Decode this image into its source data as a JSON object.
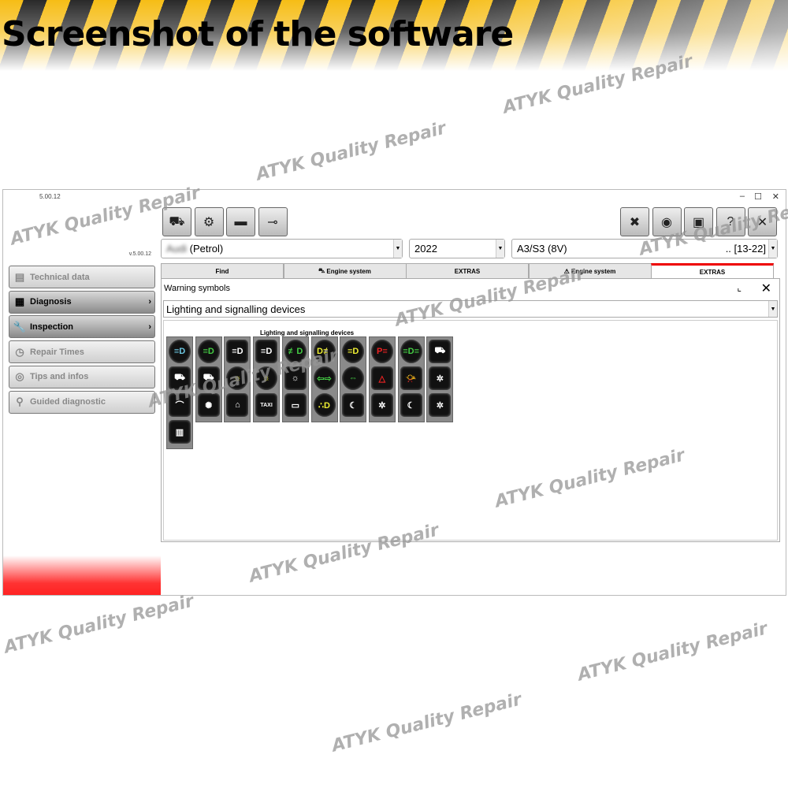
{
  "banner": {
    "title": "Screenshot of the software"
  },
  "watermark": "ATYK Quality Repair",
  "window": {
    "title": "5.00.12",
    "controls": [
      "–",
      "☐",
      "✕"
    ],
    "version": "v.5.00.12"
  },
  "sidebar": {
    "items": [
      {
        "label": "Technical data",
        "icon": "document-icon",
        "glyph": "▤",
        "active": false,
        "chevron": ""
      },
      {
        "label": "Diagnosis",
        "icon": "diagnosis-icon",
        "glyph": "▦",
        "active": true,
        "chevron": "›"
      },
      {
        "label": "Inspection",
        "icon": "wrench-icon",
        "glyph": "🔧",
        "active": true,
        "chevron": "›"
      },
      {
        "label": "Repair Times",
        "icon": "clock-icon",
        "glyph": "◷",
        "active": false,
        "chevron": ""
      },
      {
        "label": "Tips and infos",
        "icon": "lightbulb-icon",
        "glyph": "◎",
        "active": false,
        "chevron": ""
      },
      {
        "label": "Guided diagnostic",
        "icon": "magnifier-icon",
        "glyph": "⚲",
        "active": false,
        "chevron": ""
      }
    ]
  },
  "toolbar": {
    "left": [
      {
        "icon": "cars-icon",
        "glyph": "⛟"
      },
      {
        "icon": "engine-icon",
        "glyph": "⚙"
      },
      {
        "icon": "battery-icon",
        "glyph": "▬"
      },
      {
        "icon": "connector-icon",
        "glyph": "⊸"
      }
    ],
    "right": [
      {
        "icon": "tools-icon",
        "glyph": "✖"
      },
      {
        "icon": "wheel-icon",
        "glyph": "◉"
      },
      {
        "icon": "gearbox-icon",
        "glyph": "▣"
      },
      {
        "icon": "help-icon",
        "glyph": "?"
      },
      {
        "icon": "close-icon",
        "glyph": "✕"
      }
    ]
  },
  "selectors": {
    "make": "(Petrol)",
    "year": "2022",
    "model": "A3/S3 (8V)",
    "model_range": ".. [13-22]"
  },
  "tabs": [
    {
      "label": "Find",
      "icon": ""
    },
    {
      "label": "Engine system",
      "icon": "engine-icon"
    },
    {
      "label": "EXTRAS",
      "icon": ""
    },
    {
      "label": "Engine system",
      "icon": "warning-icon"
    },
    {
      "label": "EXTRAS",
      "icon": "",
      "active": true
    }
  ],
  "panel": {
    "title": "Warning symbols",
    "category": "Lighting and signalling devices",
    "grid_label": "Lighting and signalling devices"
  },
  "colors": {
    "accent": "#e00000",
    "active_tab": "#e00000"
  },
  "symbols": [
    [
      {
        "g": "≡D",
        "c": "#6cc6e0",
        "n": "low-beam-icon",
        "r": 1
      },
      {
        "g": "⛟",
        "c": "#fff",
        "n": "tow-truck-icon"
      },
      {
        "g": "⌒",
        "c": "#fff",
        "n": "work-light-icon"
      },
      {
        "g": "▥",
        "c": "#fff",
        "n": "interior-light-icon"
      }
    ],
    [
      {
        "g": "≡D",
        "c": "#4c4",
        "n": "high-beam-icon",
        "r": 1
      },
      {
        "g": "⛟",
        "c": "#fff",
        "n": "truck-light-icon"
      },
      {
        "g": "✺",
        "c": "#fff",
        "n": "search-light-icon"
      }
    ],
    [
      {
        "g": "≡D",
        "c": "#fff",
        "n": "headlight-range-icon"
      },
      {
        "g": "☼",
        "c": "#ee3",
        "n": "exterior-bulb-icon",
        "r": 1
      },
      {
        "g": "⌂",
        "c": "#fff",
        "n": "beacon-icon"
      }
    ],
    [
      {
        "g": "≡D",
        "c": "#fff",
        "n": "headlight-adjust-icon"
      },
      {
        "g": "☼",
        "c": "#ee3",
        "n": "bulb-failure-icon",
        "r": 1
      },
      {
        "g": "TAXI",
        "c": "#fff",
        "n": "taxi-icon"
      }
    ],
    [
      {
        "g": "≢D",
        "c": "#4c4",
        "n": "front-fog-icon",
        "r": 1
      },
      {
        "g": "☼",
        "c": "#fff",
        "n": "dimmer-icon"
      },
      {
        "g": "▭",
        "c": "#fff",
        "n": "roof-light-icon"
      }
    ],
    [
      {
        "g": "D≢",
        "c": "#ee3",
        "n": "rear-fog-icon",
        "r": 1
      },
      {
        "g": "⇦⇨",
        "c": "#4c4",
        "n": "turn-signal-icon",
        "r": 1
      },
      {
        "g": "∴D",
        "c": "#ee3",
        "n": "parking-light-icon",
        "r": 1
      }
    ],
    [
      {
        "g": "≡D",
        "c": "#ee3",
        "n": "main-beam-icon",
        "r": 1
      },
      {
        "g": "⇔",
        "c": "#4c4",
        "n": "trailer-signal-icon",
        "r": 1
      },
      {
        "g": "☾",
        "c": "#fff",
        "n": "road-light-icon"
      }
    ],
    [
      {
        "g": "P≡",
        "c": "#e22",
        "n": "parking-lights-icon",
        "r": 1
      },
      {
        "g": "△",
        "c": "#e22",
        "n": "hazard-icon"
      },
      {
        "g": "✲",
        "c": "#fff",
        "n": "footwell-light-icon"
      }
    ],
    [
      {
        "g": "≡D≡",
        "c": "#4c4",
        "n": "side-lights-icon",
        "r": 1
      },
      {
        "g": "📯",
        "c": "#fff",
        "n": "horn-icon"
      },
      {
        "g": "☾",
        "c": "#fff",
        "n": "night-light-icon"
      }
    ],
    [
      {
        "g": "⛟",
        "c": "#fff",
        "n": "trailer-truck-icon"
      },
      {
        "g": "✲",
        "c": "#fff",
        "n": "ceiling-light-icon"
      },
      {
        "g": "✲",
        "c": "#fff",
        "n": "bed-light-icon"
      }
    ]
  ]
}
